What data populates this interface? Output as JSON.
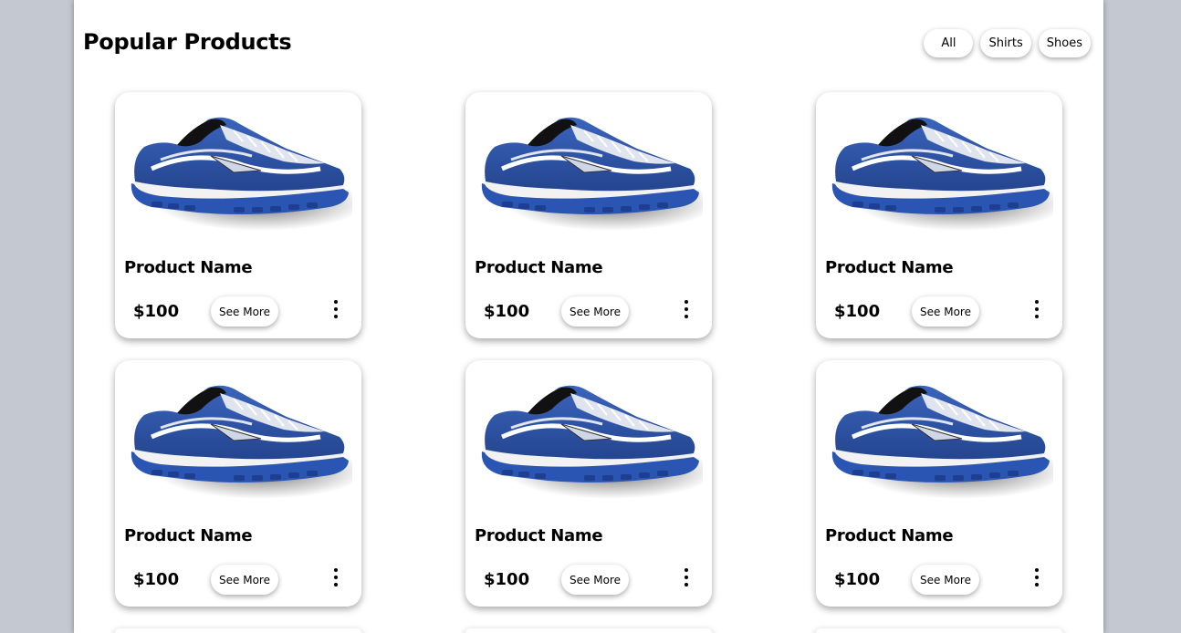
{
  "header": {
    "title": "Popular Products"
  },
  "filters": [
    {
      "label": "All"
    },
    {
      "label": "Shirts"
    },
    {
      "label": "Shoes"
    }
  ],
  "products": [
    {
      "name": "Product Name",
      "price": "$100",
      "action_label": "See More",
      "image_icon": "running-shoe-image",
      "menu_icon": "more-vertical-icon"
    },
    {
      "name": "Product Name",
      "price": "$100",
      "action_label": "See More",
      "image_icon": "running-shoe-image",
      "menu_icon": "more-vertical-icon"
    },
    {
      "name": "Product Name",
      "price": "$100",
      "action_label": "See More",
      "image_icon": "running-shoe-image",
      "menu_icon": "more-vertical-icon"
    },
    {
      "name": "Product Name",
      "price": "$100",
      "action_label": "See More",
      "image_icon": "running-shoe-image",
      "menu_icon": "more-vertical-icon"
    },
    {
      "name": "Product Name",
      "price": "$100",
      "action_label": "See More",
      "image_icon": "running-shoe-image",
      "menu_icon": "more-vertical-icon"
    },
    {
      "name": "Product Name",
      "price": "$100",
      "action_label": "See More",
      "image_icon": "running-shoe-image",
      "menu_icon": "more-vertical-icon"
    }
  ],
  "colors": {
    "background": "#c4c8d0",
    "page": "#ffffff",
    "shoe_blue": "#2f56a8",
    "shoe_dark": "#1d2f6e"
  }
}
